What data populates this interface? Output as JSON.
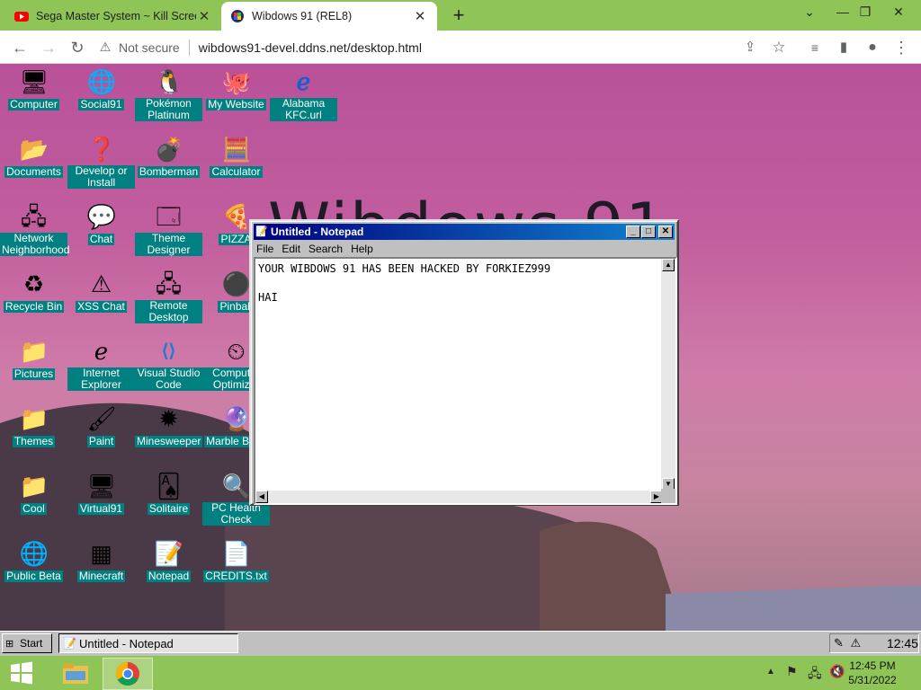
{
  "browser": {
    "tabs": [
      {
        "title": "Sega Master System ~ Kill Screen",
        "close": "✕"
      },
      {
        "title": "Wibdows 91 (REL8)",
        "close": "✕"
      }
    ],
    "new_tab": "+",
    "window_controls": {
      "chevron": "⌄",
      "minimize": "—",
      "restore": "❐",
      "close": "✕"
    },
    "security_label": "Not secure",
    "url": "wibdows91-devel.ddns.net/desktop.html"
  },
  "desktop": {
    "background_text": "Wibdows 91",
    "icons": [
      {
        "label": "Computer",
        "glyph": "🖥"
      },
      {
        "label": "Social91",
        "glyph": "🌐"
      },
      {
        "label": "Pokémon Platinum",
        "glyph": "🐧"
      },
      {
        "label": "My Website",
        "glyph": "🐙"
      },
      {
        "label": "Alabama KFC.url",
        "glyph": "ℯ"
      },
      {
        "label": "Documents",
        "glyph": "📂"
      },
      {
        "label": "Develop or Install",
        "glyph": "❓"
      },
      {
        "label": "Bomberman",
        "glyph": "💣"
      },
      {
        "label": "Calculator",
        "glyph": "🧮"
      },
      {
        "label": "Network Neighborhood",
        "glyph": "🖧"
      },
      {
        "label": "Chat",
        "glyph": "💬"
      },
      {
        "label": "Theme Designer",
        "glyph": "🗔"
      },
      {
        "label": "PIZZA",
        "glyph": "🍕"
      },
      {
        "label": "Recycle Bin",
        "glyph": "♻"
      },
      {
        "label": "XSS Chat",
        "glyph": "⚠"
      },
      {
        "label": "Remote Desktop",
        "glyph": "🖧"
      },
      {
        "label": "Pinball",
        "glyph": "⚫"
      },
      {
        "label": "Pictures",
        "glyph": "📁"
      },
      {
        "label": "Internet Explorer",
        "glyph": "ℯ"
      },
      {
        "label": "Visual Studio Code",
        "glyph": "⟨⟩"
      },
      {
        "label": "Computer Optimizer",
        "glyph": "⏲"
      },
      {
        "label": "Themes",
        "glyph": "📁"
      },
      {
        "label": "Paint",
        "glyph": "🖌"
      },
      {
        "label": "Minesweeper",
        "glyph": "✹"
      },
      {
        "label": "Marble Blast",
        "glyph": "🔮"
      },
      {
        "label": "Cool",
        "glyph": "📁"
      },
      {
        "label": "Virtual91",
        "glyph": "🖥"
      },
      {
        "label": "Solitaire",
        "glyph": "🂡"
      },
      {
        "label": "PC Health Check",
        "glyph": "🔍"
      },
      {
        "label": "Public Beta",
        "glyph": "🌐"
      },
      {
        "label": "Minecraft",
        "glyph": "▦"
      },
      {
        "label": "Notepad",
        "glyph": "📝"
      },
      {
        "label": "CREDITS.txt",
        "glyph": "📄"
      }
    ]
  },
  "notepad": {
    "title": "Untitled - Notepad",
    "menu": [
      "File",
      "Edit",
      "Search",
      "Help"
    ],
    "content": "YOUR WIBDOWS 91 HAS BEEN HACKED BY FORKIEZ999\n\nHAI",
    "controls": {
      "minimize": "_",
      "maximize": "□",
      "close": "✕"
    }
  },
  "taskbar": {
    "start_label": "Start",
    "items": [
      "Untitled - Notepad"
    ],
    "clock": "12:45"
  },
  "host_taskbar": {
    "time": "12:45 PM",
    "date": "5/31/2022",
    "tray_arrow": "▲"
  },
  "colors": {
    "chrome_frame": "#8fc556",
    "icon_label_bg": "#008080",
    "title_bar": "#000080"
  }
}
